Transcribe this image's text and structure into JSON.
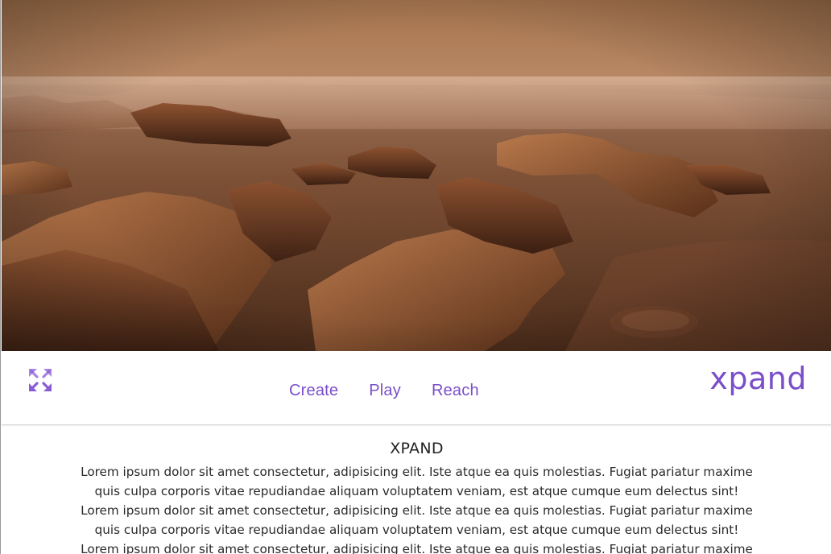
{
  "hero": {
    "image": "desert-landscape-photo"
  },
  "navbar": {
    "logo_icon": "expand-arrows-icon",
    "links": [
      {
        "label": "Create"
      },
      {
        "label": "Play"
      },
      {
        "label": "Reach"
      }
    ],
    "brand": "xpand",
    "accent_color": "#7a4fc9"
  },
  "content": {
    "heading": "XPAND",
    "paragraph": "Lorem ipsum dolor sit amet consectetur, adipisicing elit. Iste atque ea quis molestias. Fugiat pariatur maxime quis culpa corporis vitae repudiandae aliquam voluptatem veniam, est atque cumque eum delectus sint! Lorem ipsum dolor sit amet consectetur, adipisicing elit. Iste atque ea quis molestias. Fugiat pariatur maxime quis culpa corporis vitae repudiandae aliquam voluptatem veniam, est atque cumque eum delectus sint! Lorem ipsum dolor sit amet consectetur, adipisicing elit. Iste atque ea quis molestias. Fugiat pariatur maxime quis culpa corporis vitae repudiandae aliquam voluptatem veniam, est atque cumque eum delectus sint!"
  }
}
